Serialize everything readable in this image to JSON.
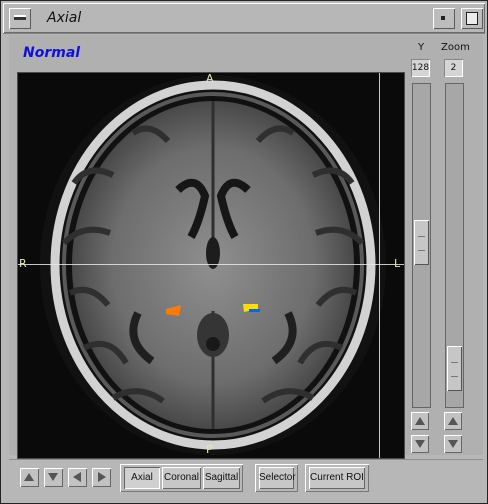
{
  "window": {
    "title": "Axial"
  },
  "view": {
    "mode": "Normal",
    "orientation": {
      "anterior": "A",
      "posterior": "P",
      "right": "R",
      "left": "L"
    }
  },
  "controls": {
    "y_label": "Y",
    "y_value": "128",
    "zoom_label": "Zoom",
    "zoom_value": "2"
  },
  "buttons": {
    "axial": "Axial",
    "coronal": "Coronal",
    "sagittal": "Sagittal",
    "selector": "Selector",
    "current_roi": "Current ROI"
  },
  "icons": {
    "window_menu": "window-menu-icon",
    "minimize": "minimize-icon",
    "maximize": "maximize-icon",
    "nav_up": "arrow-up-icon",
    "nav_down": "arrow-down-icon",
    "nav_left": "arrow-left-icon",
    "nav_right": "arrow-right-icon"
  },
  "colors": {
    "mode_text": "#1010dd",
    "roi_left": "#ff7a00",
    "roi_right": "#0066ff"
  }
}
